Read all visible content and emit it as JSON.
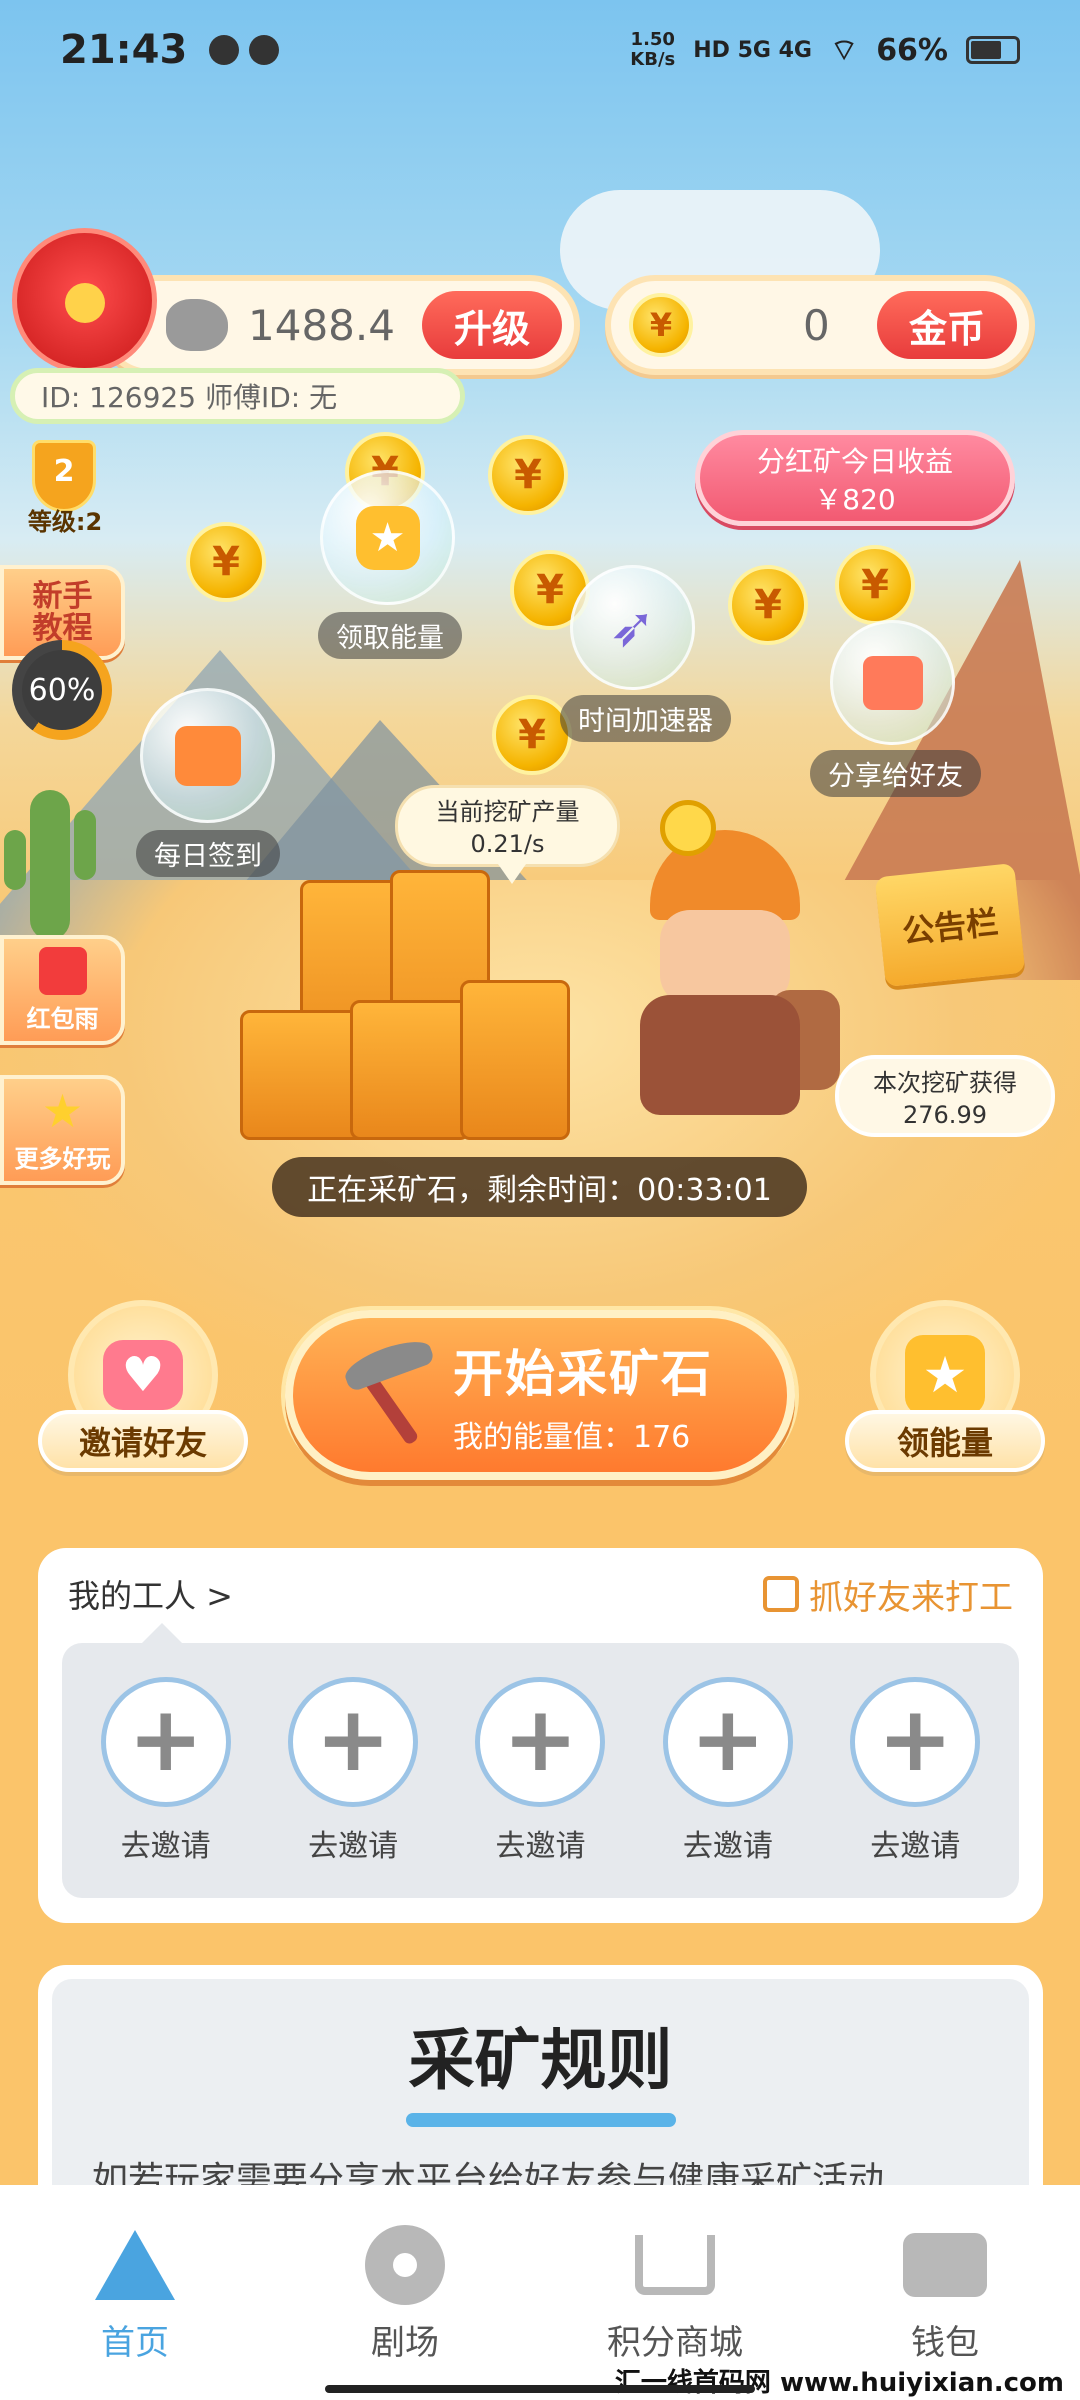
{
  "status_bar": {
    "time": "21:43",
    "net_speed": "1.50\nKB/s",
    "network": "HD 5G 4G",
    "battery": "66%"
  },
  "resources": {
    "stone_value": "1488.4",
    "upgrade_label": "升级",
    "coin_value": "0",
    "coin_label": "金币",
    "coin_symbol": "¥"
  },
  "user": {
    "id_text": "ID: 126925  师傅ID: 无",
    "level_num": "2",
    "level_label": "等级:2"
  },
  "side_menu": {
    "tutorial": "新手\n教程",
    "progress": "60%",
    "progress_value": 0.6,
    "red_rain": "红包雨",
    "more_play": "更多好玩"
  },
  "dividend": {
    "title": "分红矿今日收益",
    "amount": "￥820"
  },
  "bubbles": {
    "receive_energy": "领取能量",
    "time_accelerator": "时间加速器",
    "daily_signin": "每日签到",
    "share_friends": "分享给好友"
  },
  "mining": {
    "rate_title": "当前挖矿产量",
    "rate_value": "0.21/s",
    "notice": "公告栏",
    "earned_title": "本次挖矿获得",
    "earned_value": "276.99",
    "timer_text": "正在采矿石，剩余时间：00:33:01"
  },
  "actions": {
    "invite": "邀请好友",
    "start_main": "开始采矿石",
    "start_sub": "我的能量值：176",
    "get_energy": "领能量"
  },
  "workers": {
    "title": "我的工人 >",
    "catch_friends": "抓好友来打工",
    "slots": [
      "去邀请",
      "去邀请",
      "去邀请",
      "去邀请",
      "去邀请"
    ]
  },
  "rules": {
    "title": "采矿规则",
    "text": "如若玩家需要分享本平台给好友参与健康采矿活动"
  },
  "nav": {
    "home": "首页",
    "theater": "剧场",
    "points_mall": "积分商城",
    "wallet": "钱包"
  },
  "watermark": "汇一线首码网 www.huiyixian.com"
}
